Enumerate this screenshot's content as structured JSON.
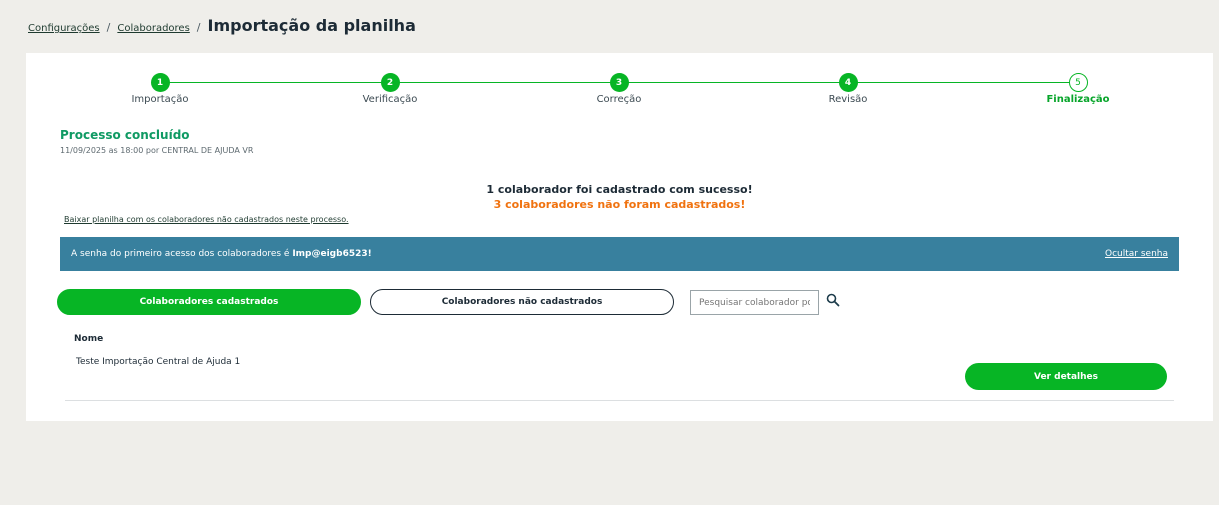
{
  "breadcrumb": {
    "items": [
      "Configurações",
      "Colaboradores"
    ],
    "current": "Importação da planilha"
  },
  "stepper": {
    "steps": [
      {
        "number": "1",
        "label": "Importação"
      },
      {
        "number": "2",
        "label": "Verificação"
      },
      {
        "number": "3",
        "label": "Correção"
      },
      {
        "number": "4",
        "label": "Revisão"
      },
      {
        "number": "5",
        "label": "Finalização"
      }
    ]
  },
  "process": {
    "title": "Processo concluído",
    "meta": "11/09/2025 as 18:00 por CENTRAL DE AJUDA VR"
  },
  "summary": {
    "success": "1 colaborador foi cadastrado com sucesso!",
    "failure": "3 colaboradores não foram cadastrados!"
  },
  "download_link": "Baixar planilha com os colaboradores não cadastrados neste processo.",
  "password_banner": {
    "prefix": "A senha do primeiro acesso dos colaboradores é ",
    "password": "Imp@eigb6523!",
    "hide_label": "Ocultar senha"
  },
  "tabs": {
    "registered": "Colaboradores cadastrados",
    "not_registered": "Colaboradores não cadastrados"
  },
  "search": {
    "placeholder": "Pesquisar colaborador por nome"
  },
  "table": {
    "column_header": "Nome",
    "rows": [
      {
        "name": "Teste Importação Central de Ajuda 1",
        "action": "Ver detalhes"
      }
    ]
  },
  "colors": {
    "primary_green": "#07b525",
    "banner_blue": "#38809e",
    "warning_orange": "#f0720f",
    "title_teal": "#0f9a63"
  }
}
